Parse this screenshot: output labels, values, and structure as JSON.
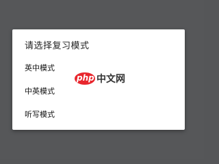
{
  "dialog": {
    "title": "请选择复习模式",
    "options": [
      {
        "label": "英中模式"
      },
      {
        "label": "中英模式"
      },
      {
        "label": "听写模式"
      }
    ]
  },
  "watermark": {
    "logo_text": "php",
    "site_text": "中文网"
  },
  "colors": {
    "backdrop": "#565759",
    "dialog_bg": "#ffffff",
    "watermark_red": "#e8262d"
  }
}
